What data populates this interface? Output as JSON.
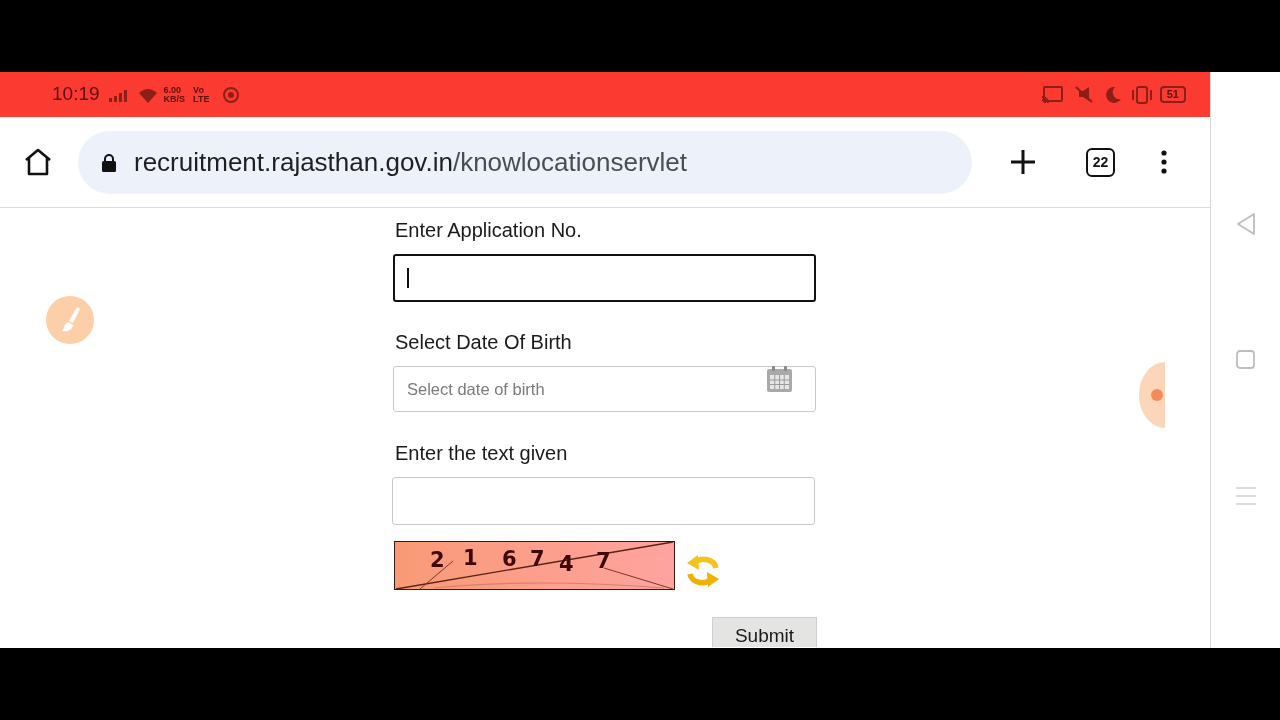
{
  "status_bar": {
    "time": "10:19",
    "data_rate": {
      "value": "6.00",
      "unit": "KB/S"
    },
    "network": {
      "voice": "Vo",
      "type": "LTE"
    },
    "battery": "51"
  },
  "browser": {
    "url": {
      "host": "recruitment.rajasthan.gov.in",
      "path": "/knowlocationservlet"
    },
    "tab_count": "22"
  },
  "form": {
    "fields": [
      {
        "kind": "text",
        "label": "Enter Application No.",
        "focused": true
      },
      {
        "kind": "date",
        "label": "Select Date Of Birth",
        "placeholder": "Select date of birth",
        "focused": false
      },
      {
        "kind": "text",
        "label": "Enter the text given",
        "focused": false
      }
    ],
    "captcha": {
      "characters": [
        "2",
        "1",
        "6",
        "7",
        "4",
        "7"
      ]
    },
    "submit": "Submit"
  }
}
